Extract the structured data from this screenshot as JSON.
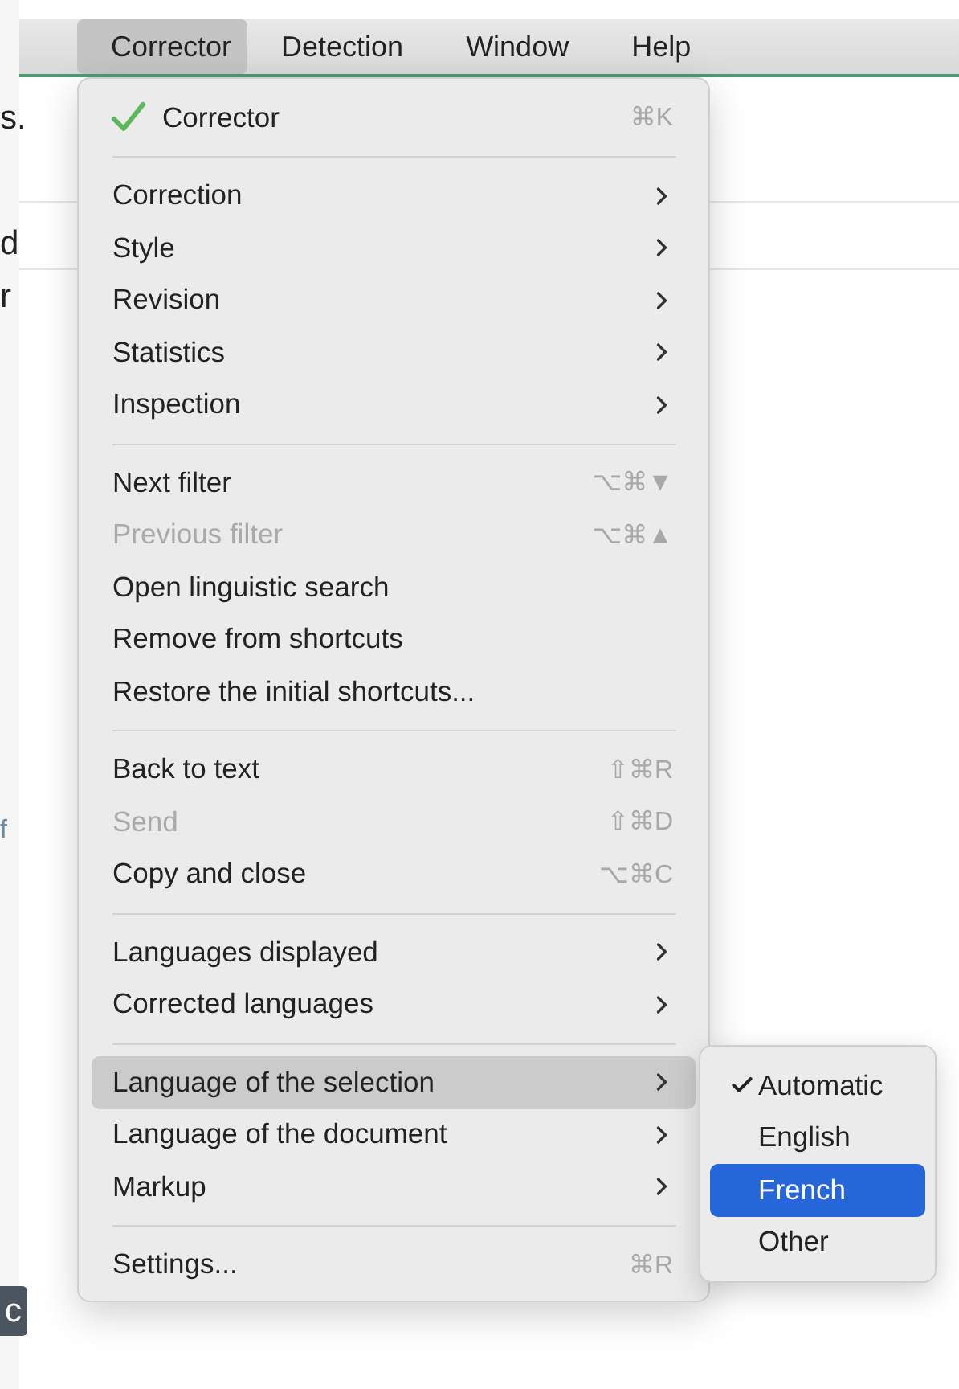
{
  "menubar": [
    {
      "label": "Corrector",
      "selected": true
    },
    {
      "label": "Detection",
      "selected": false
    },
    {
      "label": "Window",
      "selected": false
    },
    {
      "label": "Help",
      "selected": false
    }
  ],
  "background_text": [
    {
      "text": "s.",
      "kind": "plain"
    },
    {
      "text": "d",
      "kind": "plain"
    },
    {
      "text": "r",
      "kind": "plain"
    },
    {
      "text": "f",
      "kind": "link"
    },
    {
      "text": "c",
      "kind": "badge"
    }
  ],
  "menu": [
    {
      "kind": "item",
      "label": "Corrector",
      "checked": true,
      "shortcut": "⌘K",
      "submenu": false,
      "disabled": false,
      "selected": false
    },
    {
      "kind": "separator"
    },
    {
      "kind": "item",
      "label": "Correction",
      "submenu": true,
      "disabled": false,
      "selected": false
    },
    {
      "kind": "item",
      "label": "Style",
      "submenu": true,
      "disabled": false,
      "selected": false
    },
    {
      "kind": "item",
      "label": "Revision",
      "submenu": true,
      "disabled": false,
      "selected": false
    },
    {
      "kind": "item",
      "label": "Statistics",
      "submenu": true,
      "disabled": false,
      "selected": false
    },
    {
      "kind": "item",
      "label": "Inspection",
      "submenu": true,
      "disabled": false,
      "selected": false
    },
    {
      "kind": "separator"
    },
    {
      "kind": "item",
      "label": "Next filter",
      "shortcut": "⌥⌘▼",
      "submenu": false,
      "disabled": false,
      "selected": false
    },
    {
      "kind": "item",
      "label": "Previous filter",
      "shortcut": "⌥⌘▲",
      "submenu": false,
      "disabled": true,
      "selected": false
    },
    {
      "kind": "item",
      "label": "Open linguistic search",
      "submenu": false,
      "disabled": false,
      "selected": false
    },
    {
      "kind": "item",
      "label": "Remove from shortcuts",
      "submenu": false,
      "disabled": false,
      "selected": false
    },
    {
      "kind": "item",
      "label": "Restore the initial shortcuts...",
      "submenu": false,
      "disabled": false,
      "selected": false
    },
    {
      "kind": "separator"
    },
    {
      "kind": "item",
      "label": "Back to text",
      "shortcut": "⇧⌘R",
      "submenu": false,
      "disabled": false,
      "selected": false
    },
    {
      "kind": "item",
      "label": "Send",
      "shortcut": "⇧⌘D",
      "submenu": false,
      "disabled": true,
      "selected": false
    },
    {
      "kind": "item",
      "label": "Copy and close",
      "shortcut": "⌥⌘C",
      "submenu": false,
      "disabled": false,
      "selected": false
    },
    {
      "kind": "separator"
    },
    {
      "kind": "item",
      "label": "Languages displayed",
      "submenu": true,
      "disabled": false,
      "selected": false
    },
    {
      "kind": "item",
      "label": "Corrected languages",
      "submenu": true,
      "disabled": false,
      "selected": false
    },
    {
      "kind": "separator"
    },
    {
      "kind": "item",
      "label": "Language of the selection",
      "submenu": true,
      "disabled": false,
      "selected": true
    },
    {
      "kind": "item",
      "label": "Language of the document",
      "submenu": true,
      "disabled": false,
      "selected": false
    },
    {
      "kind": "item",
      "label": "Markup",
      "submenu": true,
      "disabled": false,
      "selected": false
    },
    {
      "kind": "separator"
    },
    {
      "kind": "item",
      "label": "Settings...",
      "shortcut": "⌘R",
      "submenu": false,
      "disabled": false,
      "selected": false
    }
  ],
  "submenu": [
    {
      "label": "Automatic",
      "checked": true,
      "selected": false
    },
    {
      "label": "English",
      "checked": false,
      "selected": false
    },
    {
      "label": "French",
      "checked": false,
      "selected": true
    },
    {
      "label": "Other",
      "checked": false,
      "selected": false
    }
  ]
}
